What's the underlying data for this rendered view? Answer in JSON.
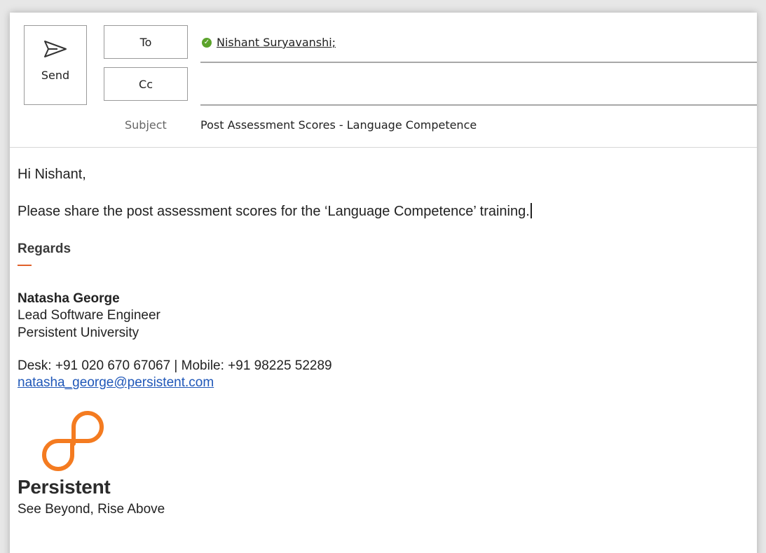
{
  "compose": {
    "send_label": "Send",
    "to_label": "To",
    "cc_label": "Cc",
    "subject_label": "Subject",
    "recipient": "Nishant Suryavanshi;",
    "subject": "Post Assessment Scores - Language Competence"
  },
  "body": {
    "greeting": "Hi Nishant,",
    "message": "Please share the post assessment scores for the ‘Language Competence’ training."
  },
  "signature": {
    "regards": "Regards",
    "name": "Natasha George",
    "title": "Lead Software Engineer",
    "org": "Persistent University",
    "phone": "Desk: +91 020 670 67067 | Mobile: +91 98225 52289",
    "email": "natasha_george@persistent.com",
    "brand": "Persistent",
    "tagline": "See Beyond, Rise Above"
  },
  "icons": {
    "send": "send-icon",
    "recipient_status": "check-circle-icon",
    "logo": "persistent-logo-icon"
  },
  "colors": {
    "accent": "#e0602a",
    "logo": "#f47b20",
    "link": "#1f57b8",
    "recipient_ok": "#5ba32b"
  }
}
